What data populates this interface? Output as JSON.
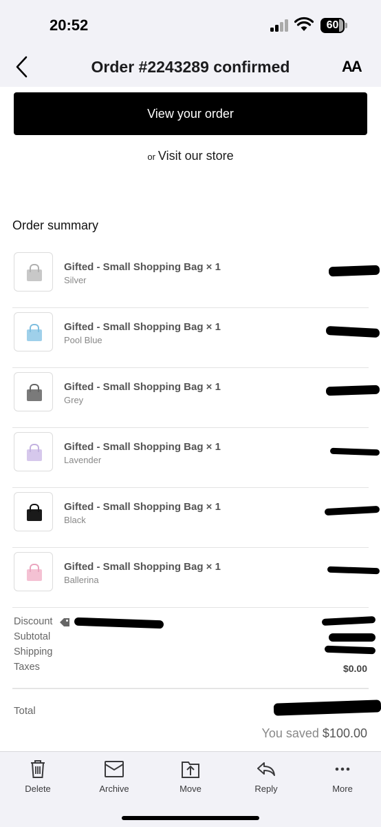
{
  "status_bar": {
    "time": "20:52",
    "battery": "60"
  },
  "nav": {
    "title": "Order #2243289 confirmed",
    "text_size_label": "AA",
    "back_icon": "chevron-left-icon"
  },
  "actions": {
    "view_order_label": "View your order",
    "or_label": "or",
    "visit_store_label": "Visit our store"
  },
  "summary": {
    "title": "Order summary",
    "items": [
      {
        "name": "Gifted - Small Shopping Bag × 1",
        "variant": "Silver",
        "color": "#b8b8b8"
      },
      {
        "name": "Gifted - Small Shopping Bag × 1",
        "variant": "Pool Blue",
        "color": "#9fd0ea"
      },
      {
        "name": "Gifted - Small Shopping Bag × 1",
        "variant": "Grey",
        "color": "#7a7a7a"
      },
      {
        "name": "Gifted - Small Shopping Bag × 1",
        "variant": "Lavender",
        "color": "#d6c8ec"
      },
      {
        "name": "Gifted - Small Shopping Bag × 1",
        "variant": "Black",
        "color": "#1a1a1a"
      },
      {
        "name": "Gifted - Small Shopping Bag × 1",
        "variant": "Ballerina",
        "color": "#f4c1d3"
      }
    ]
  },
  "totals": {
    "discount_label": "Discount",
    "subtotal_label": "Subtotal",
    "shipping_label": "Shipping",
    "taxes_label": "Taxes",
    "taxes_value": "$0.00",
    "total_label": "Total",
    "saved_prefix": "You saved",
    "saved_amount": "$100.00"
  },
  "toolbar": {
    "delete": "Delete",
    "archive": "Archive",
    "move": "Move",
    "reply": "Reply",
    "more": "More"
  }
}
